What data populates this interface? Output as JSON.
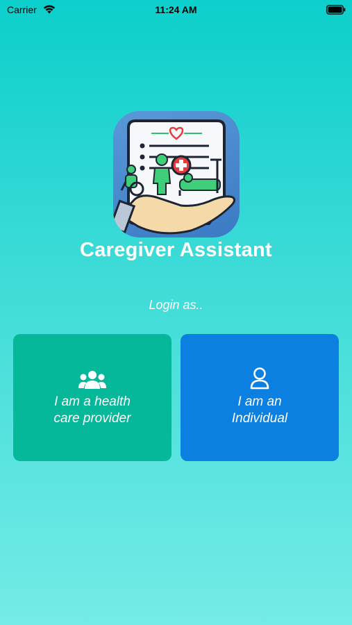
{
  "status_bar": {
    "carrier": "Carrier",
    "time": "11:24 AM"
  },
  "app": {
    "title": "Caregiver Assistant"
  },
  "login": {
    "prompt": "Login as..",
    "options": [
      {
        "label": "I am a health\ncare provider",
        "icon": "group-icon",
        "color": "#05b899"
      },
      {
        "label": "I am an\nIndividual",
        "icon": "person-icon",
        "color": "#0c80e0"
      }
    ]
  }
}
